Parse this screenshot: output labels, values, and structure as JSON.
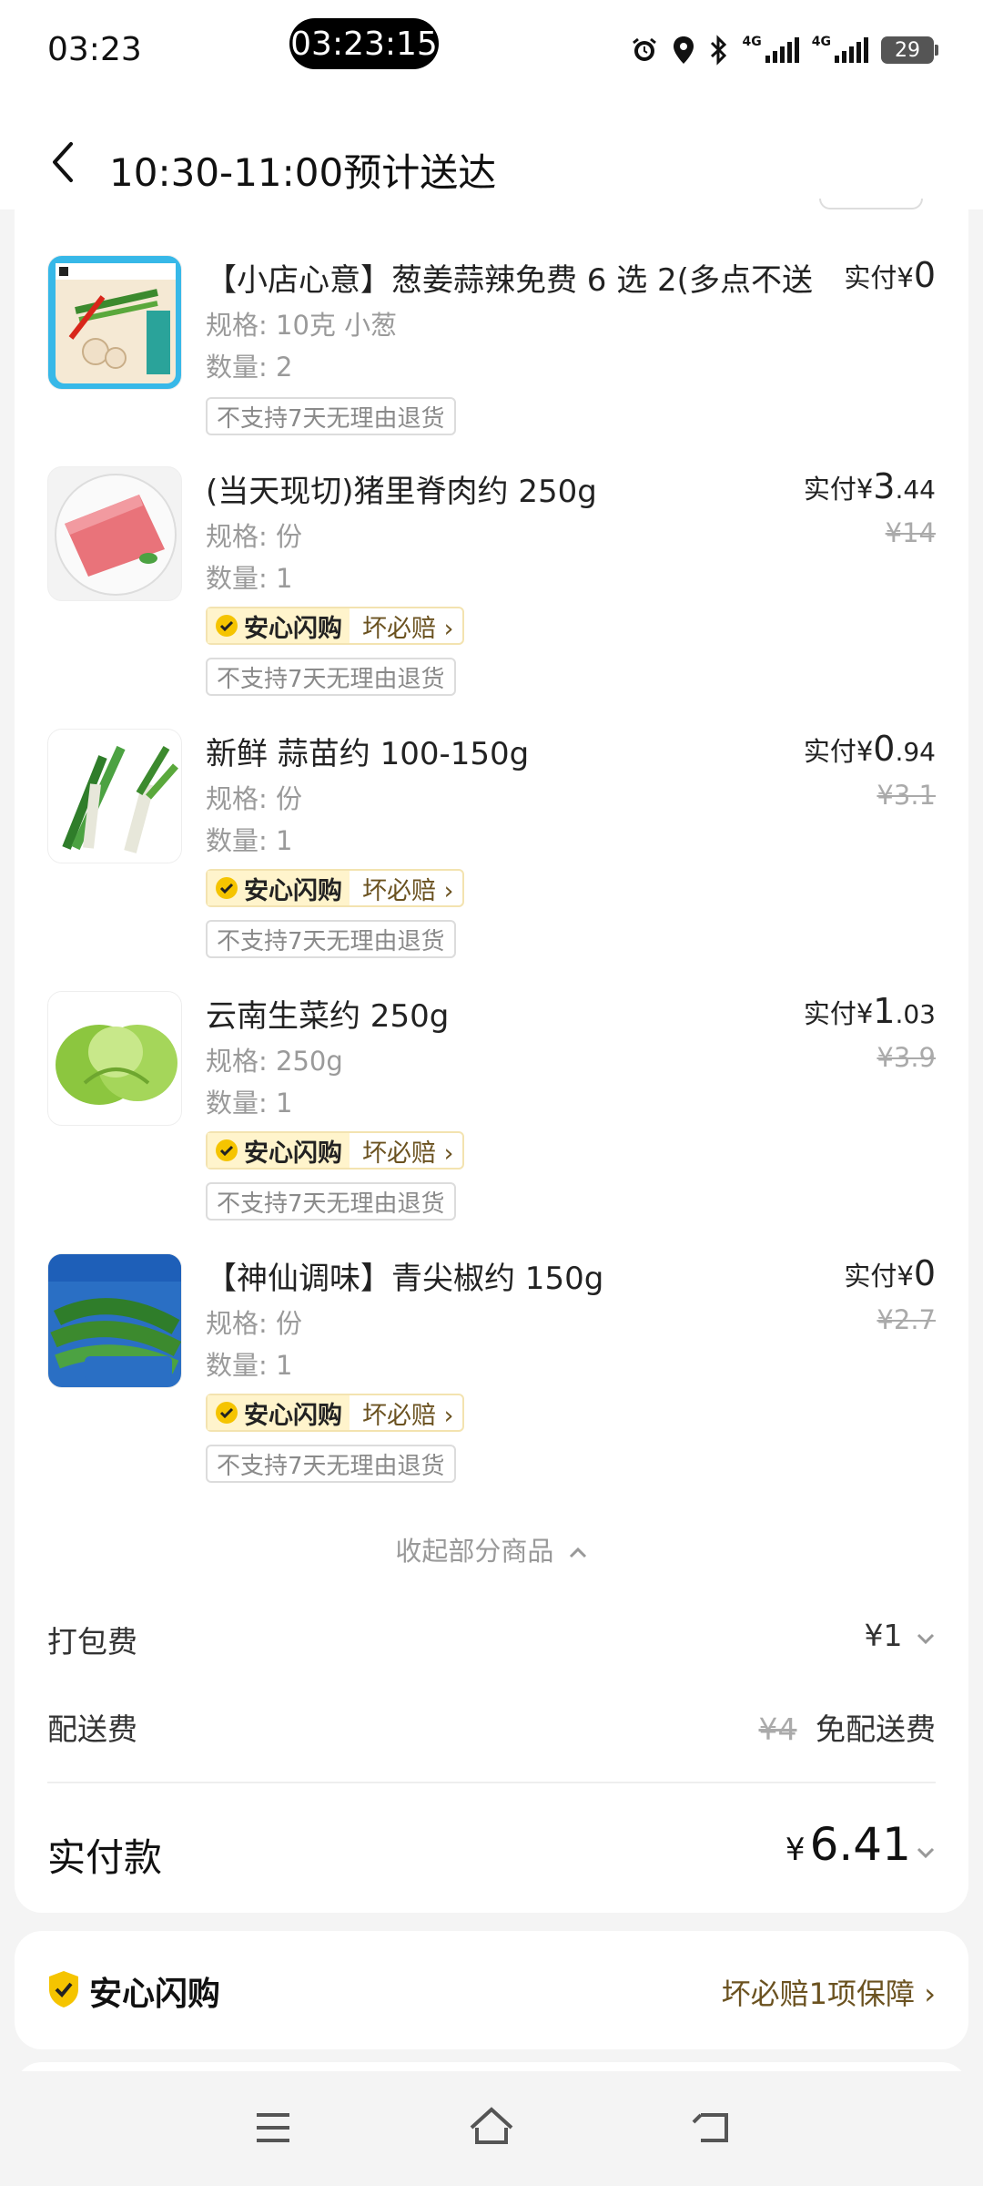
{
  "status_bar": {
    "time": "03:23",
    "pill_time": "03:23:15",
    "network_1": "4G",
    "network_2": "4G",
    "battery": "29"
  },
  "header": {
    "title": "10:30-11:00预计送达"
  },
  "items": [
    {
      "name": "【小店心意】葱姜蒜辣免费 6 选 2(多点不送",
      "spec": "规格: 10克 小葱",
      "qty": "数量: 2",
      "paid_label": "实付",
      "currency": "¥",
      "price_int": "0",
      "price_dec": "",
      "original": "",
      "assure_label": "",
      "assure_right": "",
      "no_return": "不支持7天无理由退货"
    },
    {
      "name": "(当天现切)猪里脊肉约 250g",
      "spec": "规格: 份",
      "qty": "数量: 1",
      "paid_label": "实付",
      "currency": "¥",
      "price_int": "3",
      "price_dec": ".44",
      "original": "¥14",
      "assure_label": "安心闪购",
      "assure_right": "坏必赔 ›",
      "no_return": "不支持7天无理由退货"
    },
    {
      "name": "新鲜 蒜苗约 100-150g",
      "spec": "规格: 份",
      "qty": "数量: 1",
      "paid_label": "实付",
      "currency": "¥",
      "price_int": "0",
      "price_dec": ".94",
      "original": "¥3.1",
      "assure_label": "安心闪购",
      "assure_right": "坏必赔 ›",
      "no_return": "不支持7天无理由退货"
    },
    {
      "name": "云南生菜约 250g",
      "spec": "规格: 250g",
      "qty": "数量: 1",
      "paid_label": "实付",
      "currency": "¥",
      "price_int": "1",
      "price_dec": ".03",
      "original": "¥3.9",
      "assure_label": "安心闪购",
      "assure_right": "坏必赔 ›",
      "no_return": "不支持7天无理由退货"
    },
    {
      "name": "【神仙调味】青尖椒约 150g",
      "spec": "规格: 份",
      "qty": "数量: 1",
      "paid_label": "实付",
      "currency": "¥",
      "price_int": "0",
      "price_dec": "",
      "original": "¥2.7",
      "assure_label": "安心闪购",
      "assure_right": "坏必赔 ›",
      "no_return": "不支持7天无理由退货"
    }
  ],
  "collapse_label": "收起部分商品",
  "fees": {
    "packing_label": "打包费",
    "packing_value": "¥1",
    "delivery_label": "配送费",
    "delivery_original": "¥4",
    "delivery_value": "免配送费"
  },
  "total": {
    "label": "实付款",
    "currency": "¥",
    "value": "6.41"
  },
  "assure_card": {
    "title": "安心闪购",
    "right": "坏必赔1项保障 ›"
  },
  "colors": {
    "accent_gold": "#f5c400",
    "brown_text": "#6b5220"
  }
}
